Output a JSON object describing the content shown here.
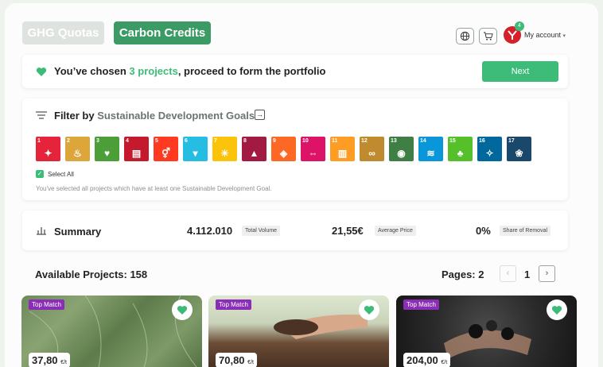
{
  "header": {
    "tabs": [
      {
        "label": "GHG Quotas",
        "active": false
      },
      {
        "label": "Carbon Credits",
        "active": true
      }
    ],
    "icons": [
      "globe-icon",
      "cart-icon"
    ],
    "notification_count": "4",
    "account_label": "My account"
  },
  "selection_bar": {
    "prefix": "You’ve chosen ",
    "highlight": "3 projects",
    "suffix": ", proceed to form the portfolio",
    "next_label": "Next"
  },
  "filter": {
    "title": "Filter by ",
    "subtitle": "Sustainable Development Goals",
    "sdgs": [
      {
        "n": "1",
        "color": "#e5243b",
        "icon": "✦"
      },
      {
        "n": "2",
        "color": "#dda63a",
        "icon": "♨"
      },
      {
        "n": "3",
        "color": "#4c9f38",
        "icon": "♥"
      },
      {
        "n": "4",
        "color": "#c5192d",
        "icon": "▤"
      },
      {
        "n": "5",
        "color": "#ff3a21",
        "icon": "⚥"
      },
      {
        "n": "6",
        "color": "#26bde2",
        "icon": "▾"
      },
      {
        "n": "7",
        "color": "#fcc30b",
        "icon": "☀"
      },
      {
        "n": "8",
        "color": "#a21942",
        "icon": "▲"
      },
      {
        "n": "9",
        "color": "#fd6925",
        "icon": "◈"
      },
      {
        "n": "10",
        "color": "#dd1367",
        "icon": "⇔"
      },
      {
        "n": "11",
        "color": "#fd9d24",
        "icon": "▥"
      },
      {
        "n": "12",
        "color": "#bf8b2e",
        "icon": "∞"
      },
      {
        "n": "13",
        "color": "#3f7e44",
        "icon": "◉"
      },
      {
        "n": "14",
        "color": "#0a97d9",
        "icon": "≋"
      },
      {
        "n": "15",
        "color": "#56c02b",
        "icon": "♣"
      },
      {
        "n": "16",
        "color": "#00689d",
        "icon": "✧"
      },
      {
        "n": "17",
        "color": "#19486a",
        "icon": "❀"
      }
    ],
    "select_all_label": "Select All",
    "note": "You've selected all projects which have at least one Sustainable Development Goal."
  },
  "summary": {
    "title": "Summary",
    "total_volume_value": "4.112.010",
    "total_volume_label": "Total Volume",
    "average_price_value": "21,55€",
    "average_price_label": "Average Price",
    "share_removal_value": "0%",
    "share_removal_label": "Share of Removal"
  },
  "projects_header": {
    "available": "Available Projects: 158",
    "pages": "Pages: 2",
    "current_page": "1"
  },
  "projects": [
    {
      "badge": "Top Match",
      "price": "37,80",
      "unit": "€/t"
    },
    {
      "badge": "Top Match",
      "price": "70,80",
      "unit": "€/t"
    },
    {
      "badge": "Top Match",
      "price": "204,00",
      "unit": "€/t"
    }
  ],
  "colors": {
    "accent": "#3dbb78",
    "brand": "#3c9a64",
    "badge": "#8a2fb5"
  }
}
